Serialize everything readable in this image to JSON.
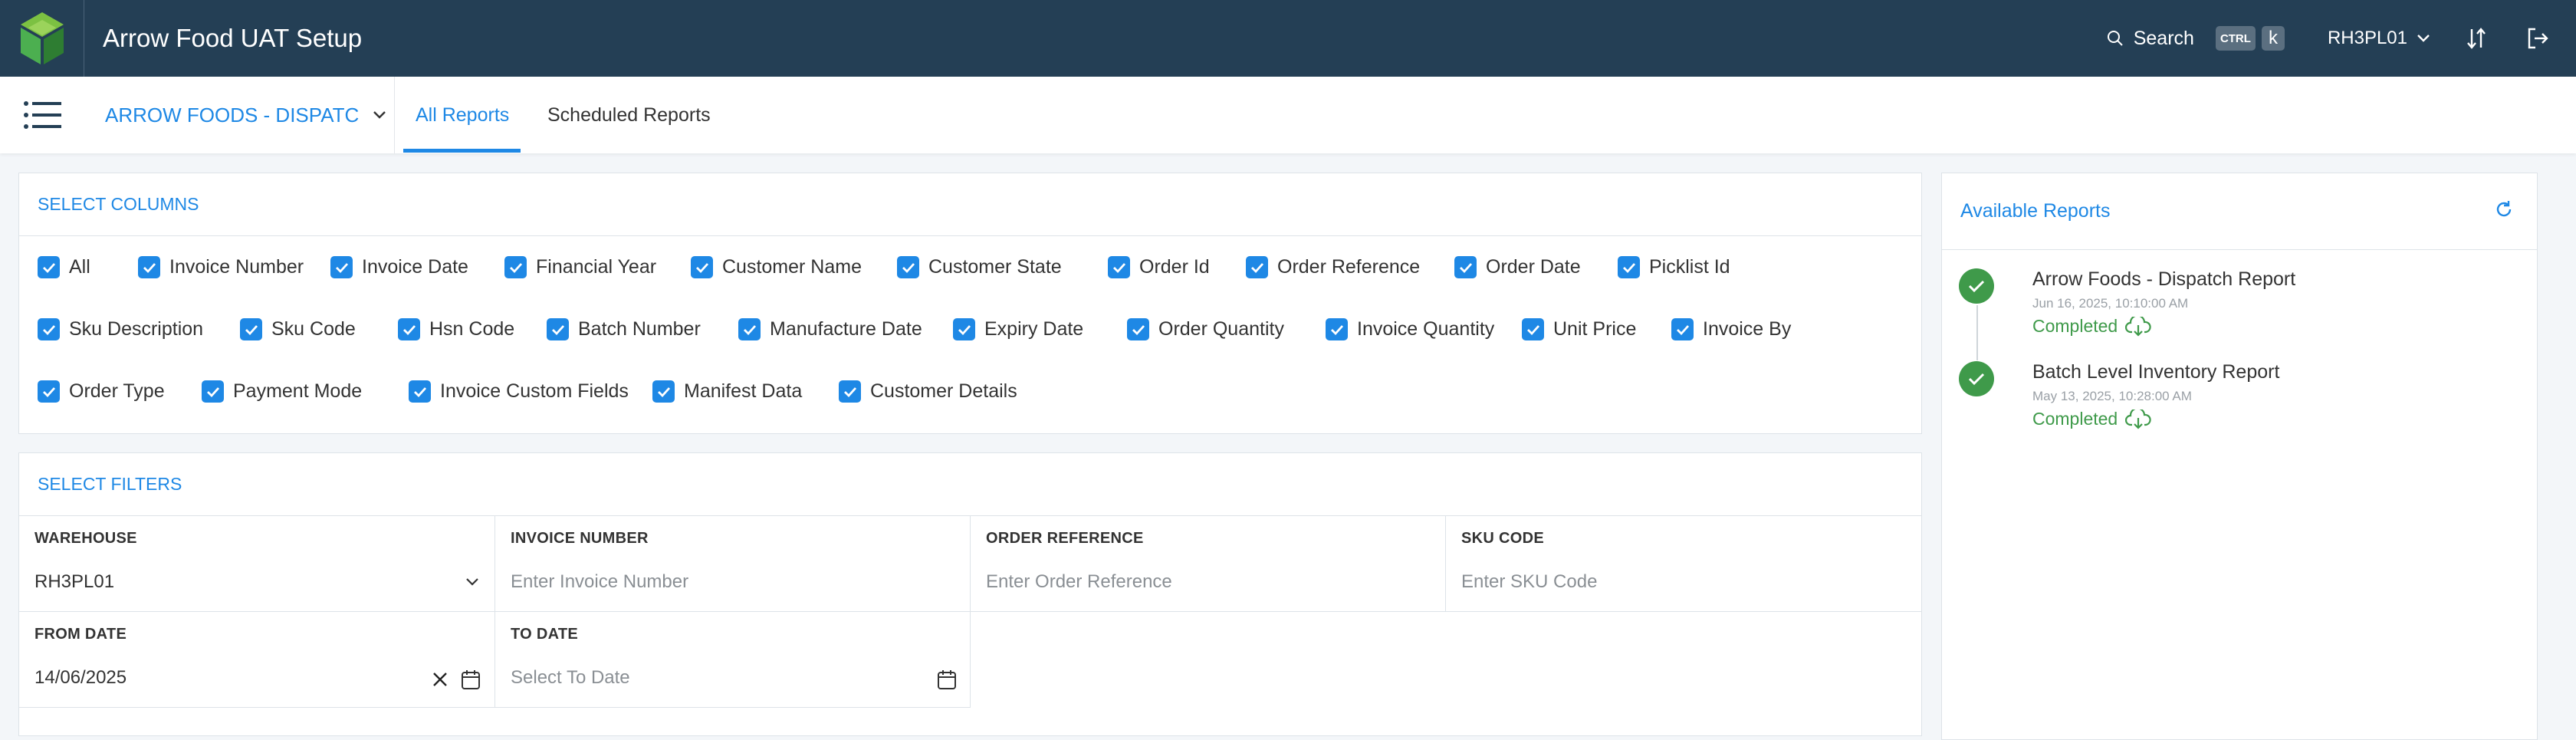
{
  "app": {
    "title": "Arrow Food UAT Setup"
  },
  "topbar": {
    "search_label": "Search",
    "shortcut_ctrl": "CTRL",
    "shortcut_key": "k",
    "user": "RH3PL01",
    "icons": [
      "search-icon",
      "chevron-down-icon",
      "sort-icon",
      "logout-icon"
    ]
  },
  "subnav": {
    "report_selector": "ARROW FOODS - DISPATC",
    "tabs": [
      {
        "label": "All Reports",
        "active": true
      },
      {
        "label": "Scheduled Reports",
        "active": false
      }
    ]
  },
  "columns": {
    "title": "SELECT COLUMNS",
    "items": [
      {
        "label": "All",
        "checked": true
      },
      {
        "label": "Invoice Number",
        "checked": true
      },
      {
        "label": "Invoice Date",
        "checked": true
      },
      {
        "label": "Financial Year",
        "checked": true
      },
      {
        "label": "Customer Name",
        "checked": true
      },
      {
        "label": "Customer State",
        "checked": true
      },
      {
        "label": "Order Id",
        "checked": true
      },
      {
        "label": "Order Reference",
        "checked": true
      },
      {
        "label": "Order Date",
        "checked": true
      },
      {
        "label": "Picklist Id",
        "checked": true
      },
      {
        "label": "Sku Description",
        "checked": true
      },
      {
        "label": "Sku Code",
        "checked": true
      },
      {
        "label": "Hsn Code",
        "checked": true
      },
      {
        "label": "Batch Number",
        "checked": true
      },
      {
        "label": "Manufacture Date",
        "checked": true
      },
      {
        "label": "Expiry Date",
        "checked": true
      },
      {
        "label": "Order Quantity",
        "checked": true
      },
      {
        "label": "Invoice Quantity",
        "checked": true
      },
      {
        "label": "Unit Price",
        "checked": true
      },
      {
        "label": "Invoice By",
        "checked": true
      },
      {
        "label": "Order Type",
        "checked": true
      },
      {
        "label": "Payment Mode",
        "checked": true
      },
      {
        "label": "Invoice Custom Fields",
        "checked": true
      },
      {
        "label": "Manifest Data",
        "checked": true
      },
      {
        "label": "Customer Details",
        "checked": true
      }
    ]
  },
  "filters": {
    "title": "SELECT FILTERS",
    "warehouse": {
      "label": "WAREHOUSE",
      "value": "RH3PL01"
    },
    "invoice_number": {
      "label": "INVOICE NUMBER",
      "placeholder": "Enter Invoice Number"
    },
    "order_reference": {
      "label": "ORDER REFERENCE",
      "placeholder": "Enter Order Reference"
    },
    "sku_code": {
      "label": "SKU CODE",
      "placeholder": "Enter SKU Code"
    },
    "from_date": {
      "label": "FROM DATE",
      "value": "14/06/2025"
    },
    "to_date": {
      "label": "TO DATE",
      "placeholder": "Select To Date"
    }
  },
  "available_reports": {
    "title": "Available Reports",
    "items": [
      {
        "name": "Arrow Foods - Dispatch Report",
        "date": "Jun 16, 2025, 10:10:00 AM",
        "status": "Completed"
      },
      {
        "name": "Batch Level Inventory Report",
        "date": "May 13, 2025, 10:28:00 AM",
        "status": "Completed"
      }
    ]
  },
  "colors": {
    "topbar": "#243f55",
    "accent": "#1e88e5",
    "success": "#3f9a4a"
  }
}
